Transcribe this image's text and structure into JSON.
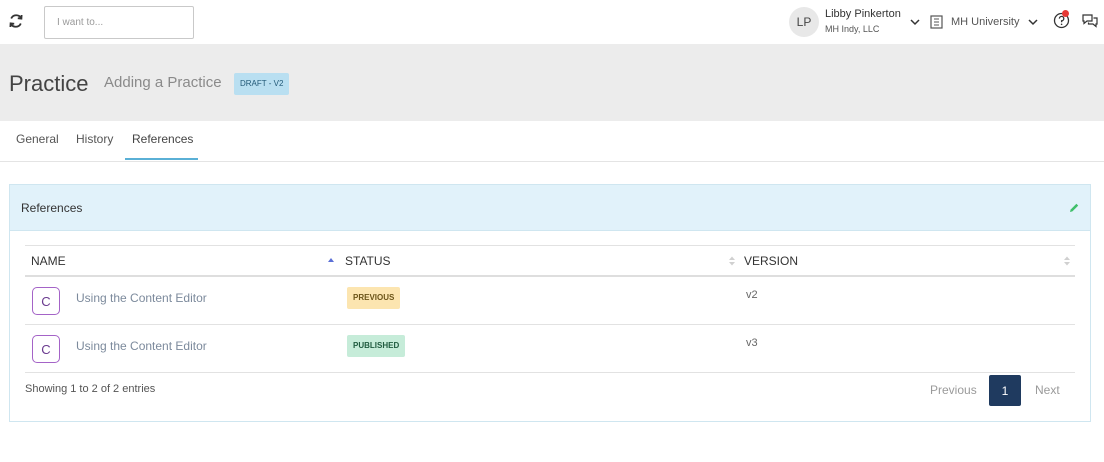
{
  "topbar": {
    "search_placeholder": "I want to...",
    "user_initials": "LP",
    "user_name": "Libby Pinkerton",
    "user_org": "MH Indy, LLC",
    "org_selector_label": "MH University"
  },
  "header": {
    "title": "Practice",
    "subtitle": "Adding a Practice",
    "badge": "DRAFT - V2"
  },
  "tabs": [
    {
      "label": "General"
    },
    {
      "label": "History"
    },
    {
      "label": "References"
    }
  ],
  "panel": {
    "title": "References",
    "columns": {
      "name": "NAME",
      "status": "STATUS",
      "version": "VERSION"
    },
    "rows": [
      {
        "type_letter": "C",
        "name": "Using the Content Editor",
        "status": "PREVIOUS",
        "version": "v2"
      },
      {
        "type_letter": "C",
        "name": "Using the Content Editor",
        "status": "PUBLISHED",
        "version": "v3"
      }
    ],
    "info": "Showing 1 to 2 of 2 entries",
    "pagination": {
      "previous": "Previous",
      "page": "1",
      "next": "Next"
    }
  },
  "colors": {
    "accent": "#5ab0d6",
    "panel_header_bg": "#e1f2fa",
    "status_previous": "#fce5b0",
    "status_published": "#c6ecd9",
    "page_active": "#1f3a5f",
    "notification_dot": "#e53935"
  }
}
